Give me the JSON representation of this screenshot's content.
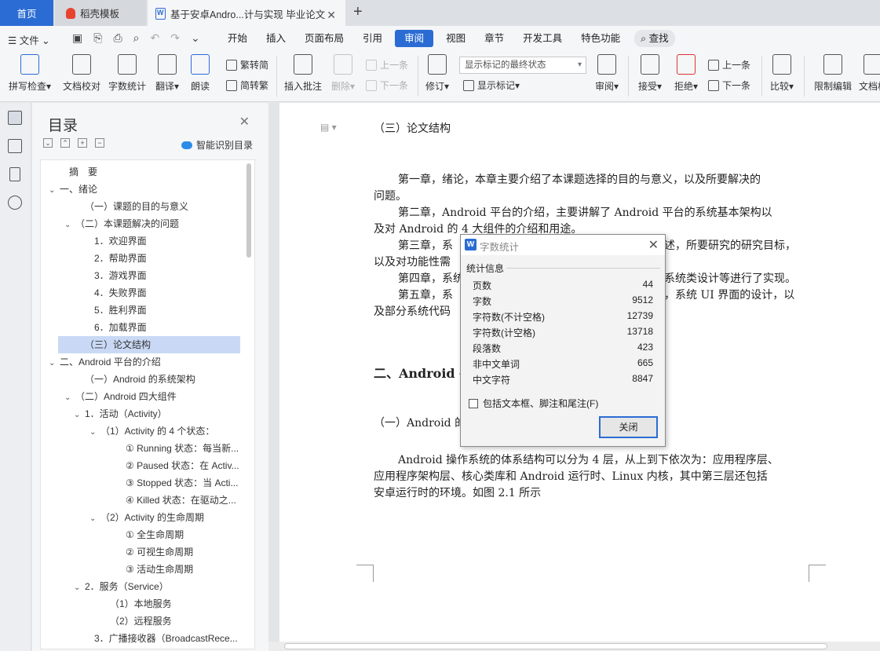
{
  "tabs": {
    "home": "首页",
    "template": "稻壳模板",
    "doc": "基于安卓Andro...计与实现 毕业论文"
  },
  "menu": {
    "file": "文件",
    "items": [
      "开始",
      "插入",
      "页面布局",
      "引用",
      "审阅",
      "视图",
      "章节",
      "开发工具",
      "特色功能"
    ],
    "active_index": 4,
    "search": "查找"
  },
  "ribbon": {
    "spell": "拼写检查",
    "proof": "文档校对",
    "count": "字数统计",
    "translate": "翻译",
    "read": "朗读",
    "to_trad": "繁转简",
    "to_simp": "简转繁",
    "insert_comment": "插入批注",
    "delete": "删除",
    "prev_comment": "上一条",
    "next_comment": "下一条",
    "revise": "修订",
    "markup_combo": "显示标记的最终状态",
    "show_markup": "显示标记",
    "review": "审阅",
    "accept": "接受",
    "reject": "拒绝",
    "prev": "上一条",
    "next": "下一条",
    "compare": "比较",
    "restrict": "限制编辑",
    "doc_perm": "文档权"
  },
  "toc": {
    "title": "目录",
    "smart": "智能识别目录",
    "items": [
      {
        "text": "摘　要",
        "indent": 0,
        "arrow": ""
      },
      {
        "text": "一、绪论",
        "indent": 0,
        "arrow": "v"
      },
      {
        "text": "（一）课题的目的与意义",
        "indent": 1,
        "arrow": ""
      },
      {
        "text": "（二）本课题解决的问题",
        "indent": 1,
        "arrow": "v"
      },
      {
        "text": "1．欢迎界面",
        "indent": 2,
        "arrow": ""
      },
      {
        "text": "2．帮助界面",
        "indent": 2,
        "arrow": ""
      },
      {
        "text": "3．游戏界面",
        "indent": 2,
        "arrow": ""
      },
      {
        "text": "4．失败界面",
        "indent": 2,
        "arrow": ""
      },
      {
        "text": "5．胜利界面",
        "indent": 2,
        "arrow": ""
      },
      {
        "text": "6．加载界面",
        "indent": 2,
        "arrow": ""
      },
      {
        "text": "（三）论文结构",
        "indent": 1,
        "arrow": "",
        "selected": true
      },
      {
        "text": "二、Android 平台的介绍",
        "indent": 0,
        "arrow": "v"
      },
      {
        "text": "（一）Android 的系统架构",
        "indent": 1,
        "arrow": ""
      },
      {
        "text": "（二）Android 四大组件",
        "indent": 1,
        "arrow": "v"
      },
      {
        "text": "1．活动（Activity）",
        "indent": 2,
        "arrow": "v"
      },
      {
        "text": "（1）Activity 的 4 个状态：",
        "indent": 3,
        "arrow": "v"
      },
      {
        "text": "① Running 状态：每当新...",
        "indent": 4,
        "arrow": ""
      },
      {
        "text": "② Paused 状态：在 Activ...",
        "indent": 4,
        "arrow": ""
      },
      {
        "text": "③ Stopped 状态：当 Acti...",
        "indent": 4,
        "arrow": ""
      },
      {
        "text": "④ Killed 状态：在驱动之...",
        "indent": 4,
        "arrow": ""
      },
      {
        "text": "（2）Activity 的生命周期",
        "indent": 3,
        "arrow": "v"
      },
      {
        "text": "① 全生命周期",
        "indent": 4,
        "arrow": ""
      },
      {
        "text": "② 可视生命周期",
        "indent": 4,
        "arrow": ""
      },
      {
        "text": "③ 活动生命周期",
        "indent": 4,
        "arrow": ""
      },
      {
        "text": "2．服务（Service）",
        "indent": 2,
        "arrow": "v"
      },
      {
        "text": "（1）本地服务",
        "indent": 3,
        "arrow": ""
      },
      {
        "text": "（2）远程服务",
        "indent": 3,
        "arrow": ""
      },
      {
        "text": "3．广播接收器（BroadcastRece...",
        "indent": 2,
        "arrow": ""
      }
    ]
  },
  "document": {
    "heading": "（三）论文结构",
    "p1a": "第一章，绪论，本章主要介绍了本课题选择的目的与意义，以及所要解决的",
    "p1b": "问题。",
    "p2a": "第二章，Android 平台的介绍，主要讲解了 Android 平台的系统基本架构以",
    "p2b": "及对 Android 的 4 大组件的介绍和用途。",
    "p3a": "第三章，系",
    "p3a_r": "述，所要研究的研究目标，",
    "p3b": "以及对功能性需",
    "p4a": "第四章，系统",
    "p4a_r": "系统类设计等进行了实现。",
    "p5a": "第五章，系",
    "p5a_r": "，系统 UI 界面的设计，以",
    "p5b": "及部分系统代码",
    "h2": "二、Android 平",
    "h3": "（一）Android 的",
    "p6a": "Android 操作系统的体系结构可以分为 4 层，从上到下依次为：应用程序层、",
    "p6b": "应用程序架构层、核心类库和 Android 运行时、Linux 内核，其中第三层还包括",
    "p6c": "安卓运行时的环境。如图 2.1 所示"
  },
  "dialog": {
    "title": "字数统计",
    "group": "统计信息",
    "rows": [
      {
        "label": "页数",
        "value": "44"
      },
      {
        "label": "字数",
        "value": "9512"
      },
      {
        "label": "字符数(不计空格)",
        "value": "12739"
      },
      {
        "label": "字符数(计空格)",
        "value": "13718"
      },
      {
        "label": "段落数",
        "value": "423"
      },
      {
        "label": "非中文单词",
        "value": "665"
      },
      {
        "label": "中文字符",
        "value": "8847"
      }
    ],
    "checkbox": "包括文本框、脚注和尾注(F)",
    "close": "关闭"
  }
}
